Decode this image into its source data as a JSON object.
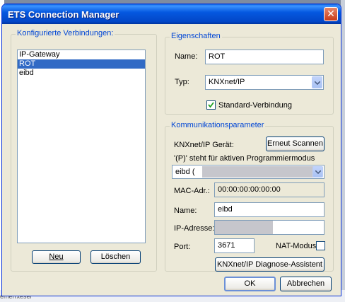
{
  "window": {
    "title": "ETS Connection Manager"
  },
  "connections": {
    "title": "Konfigurierte Verbindungen:",
    "items": [
      "IP-Gateway",
      "ROT",
      "eibd"
    ],
    "selected_index": 1,
    "new_label": "Neu",
    "delete_label": "Löschen"
  },
  "properties": {
    "title": "Eigenschaften",
    "name_label": "Name:",
    "name_value": "ROT",
    "type_label": "Typ:",
    "type_value": "KNXnet/IP",
    "default_label": "Standard-Verbindung",
    "default_checked": true
  },
  "comm": {
    "title": "Kommunikationsparameter",
    "device_label": "KNXnet/IP Gerät:",
    "rescan_label": "Erneut Scannen",
    "prog_hint": "'(P)' steht für aktiven Programmiermodus",
    "device_value": "eibd (",
    "mac_label": "MAC-Adr.:",
    "mac_value": "00:00:00:00:00:00",
    "name_label": "Name:",
    "name_value": "eibd",
    "ip_label": "IP-Adresse:",
    "ip_value": "",
    "port_label": "Port:",
    "port_value": "3671",
    "nat_label": "NAT-Modus",
    "nat_checked": false,
    "diag_label": "KNXnet/IP Diagnose-Assistent"
  },
  "footer": {
    "ok_label": "OK",
    "cancel_label": "Abbrechen"
  },
  "background": {
    "bottom_text": "emerrxesel"
  }
}
